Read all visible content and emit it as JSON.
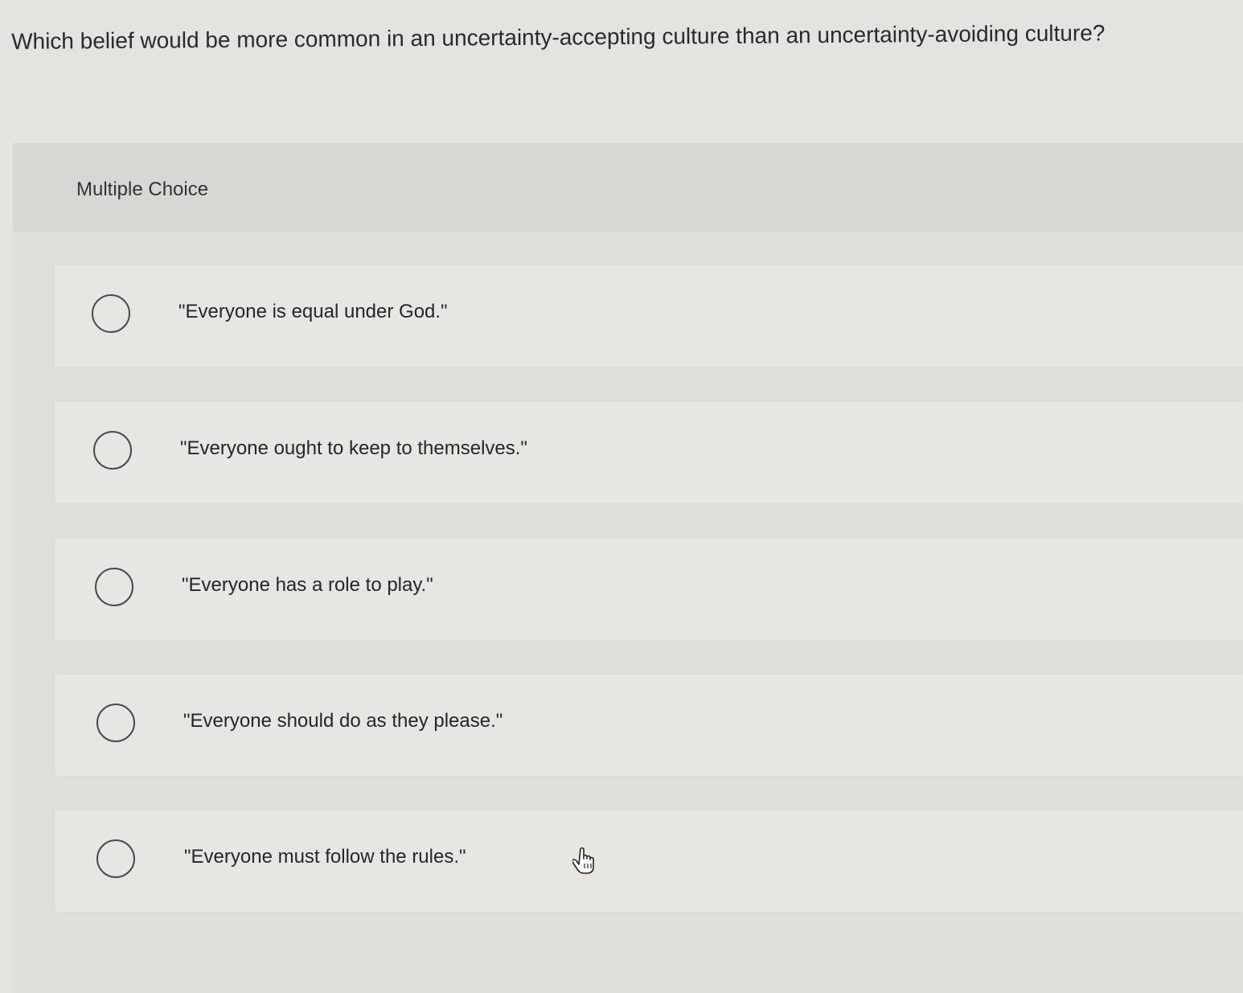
{
  "question": {
    "text": "Which belief would be more common in an uncertainty-accepting culture than an uncertainty-avoiding culture?"
  },
  "multiple_choice": {
    "label": "Multiple Choice",
    "options": [
      {
        "text": "\"Everyone is equal under God.\""
      },
      {
        "text": "\"Everyone ought to keep to themselves.\""
      },
      {
        "text": "\"Everyone has a role to play.\""
      },
      {
        "text": "\"Everyone should do as they please.\""
      },
      {
        "text": "\"Everyone must follow the rules.\""
      }
    ]
  },
  "cursor": {
    "icon": "hand-pointer-icon"
  }
}
